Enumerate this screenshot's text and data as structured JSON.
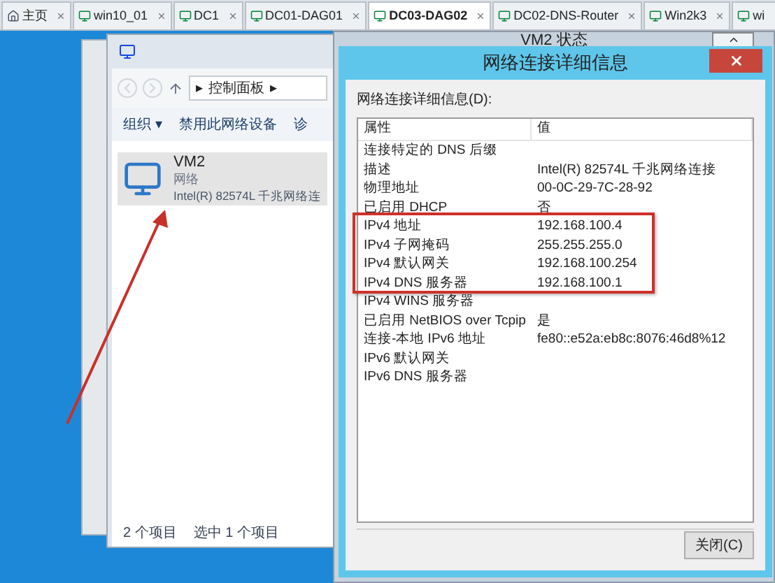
{
  "tabs": [
    {
      "label": "主页",
      "kind": "home",
      "selected": false
    },
    {
      "label": "win10_01",
      "kind": "vm",
      "selected": false
    },
    {
      "label": "DC1",
      "kind": "vm",
      "selected": false
    },
    {
      "label": "DC01-DAG01",
      "kind": "vm",
      "selected": false
    },
    {
      "label": "DC03-DAG02",
      "kind": "vm",
      "selected": true
    },
    {
      "label": "DC02-DNS-Router",
      "kind": "vm",
      "selected": false
    },
    {
      "label": "Win2k3",
      "kind": "vm",
      "selected": false
    },
    {
      "label": "wi",
      "kind": "vm",
      "selected": false
    }
  ],
  "explorer": {
    "breadcrumb": [
      "▸",
      "控制面板",
      "▸"
    ],
    "toolbar": [
      "组织 ▾",
      "禁用此网络设备",
      "诊"
    ],
    "item": {
      "name": "VM2",
      "type": "网络",
      "adapter": "Intel(R) 82574L 千兆网络连",
      "selected": true
    },
    "status_bar": [
      "2 个项目",
      "选中 1 个项目"
    ]
  },
  "status_window": {
    "title": "VM2 状态"
  },
  "dialog": {
    "title": "网络连接详细信息",
    "list_label": "网络连接详细信息(D):",
    "columns": [
      "属性",
      "值"
    ],
    "rows": [
      {
        "property": "连接特定的 DNS 后缀",
        "value": ""
      },
      {
        "property": "描述",
        "value": "Intel(R) 82574L 千兆网络连接"
      },
      {
        "property": "物理地址",
        "value": "00-0C-29-7C-28-92"
      },
      {
        "property": "已启用 DHCP",
        "value": "否"
      },
      {
        "property": "IPv4 地址",
        "value": "192.168.100.4"
      },
      {
        "property": "IPv4 子网掩码",
        "value": "255.255.255.0"
      },
      {
        "property": "IPv4 默认网关",
        "value": "192.168.100.254"
      },
      {
        "property": "IPv4 DNS 服务器",
        "value": "192.168.100.1"
      },
      {
        "property": "IPv4 WINS 服务器",
        "value": ""
      },
      {
        "property": "已启用 NetBIOS over Tcpip",
        "value": "是"
      },
      {
        "property": "连接-本地 IPv6 地址",
        "value": "fe80::e52a:eb8c:8076:46d8%12"
      },
      {
        "property": "IPv6 默认网关",
        "value": ""
      },
      {
        "property": "IPv6 DNS 服务器",
        "value": ""
      }
    ],
    "close_button": "关闭(C)"
  }
}
